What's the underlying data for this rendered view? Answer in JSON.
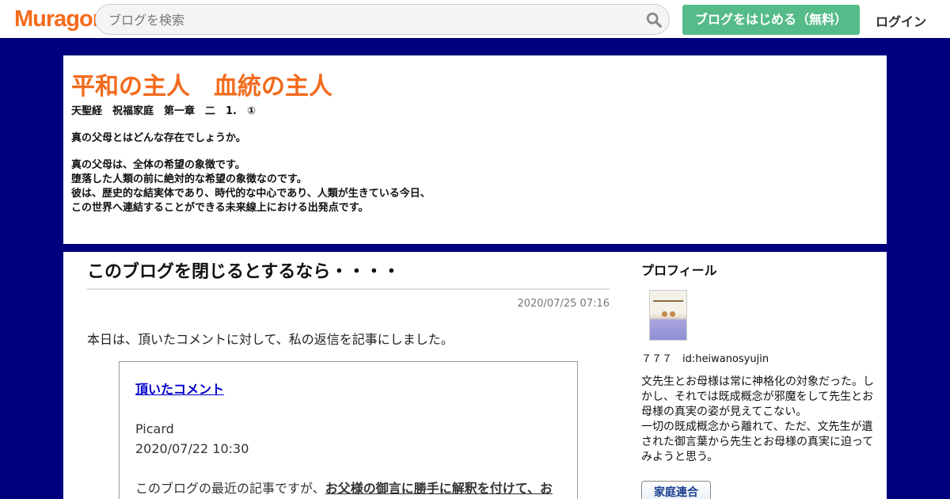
{
  "topbar": {
    "logo": "Muragon",
    "search_placeholder": "ブログを検索",
    "start_button": "ブログをはじめる（無料）",
    "login": "ログイン"
  },
  "header": {
    "title": "平和の主人　血統の主人",
    "description": [
      "天聖経　祝福家庭　第一章　二　1.　①",
      "真の父母とはどんな存在でしょうか。",
      "真の父母は、全体の希望の象徴です。",
      "堕落した人類の前に絶対的な希望の象徴なのです。",
      "彼は、歴史的な結実体であり、時代的な中心であり、人類が生きている今日、",
      "この世界へ連結することができる未来線上における出発点です。"
    ]
  },
  "article": {
    "title": "このブログを閉じるとするなら・・・・",
    "date": "2020/07/25 07:16",
    "intro": "本日は、頂いたコメントに対して、私の返信を記事にしました。",
    "quote": {
      "link": "頂いたコメント",
      "author": "Picard",
      "datetime": "2020/07/22 10:30",
      "text_start": "このブログの最近の記事ですが、",
      "text_bold": "お父様の御言に勝手に解釈を付けて、お"
    }
  },
  "sidebar": {
    "title": "プロフィール",
    "profile_id": "７７７　id:heiwanosyujin",
    "profile_text": "文先生とお母様は常に神格化の対象だった。しかし、それでは既成概念が邪魔をして先生とお母様の真実の姿が見えてこない。\n一切の既成概念から離れて、ただ、文先生が遺された御言葉から先生とお母様の真実に迫ってみようと思う。",
    "badge": "家庭連合"
  }
}
